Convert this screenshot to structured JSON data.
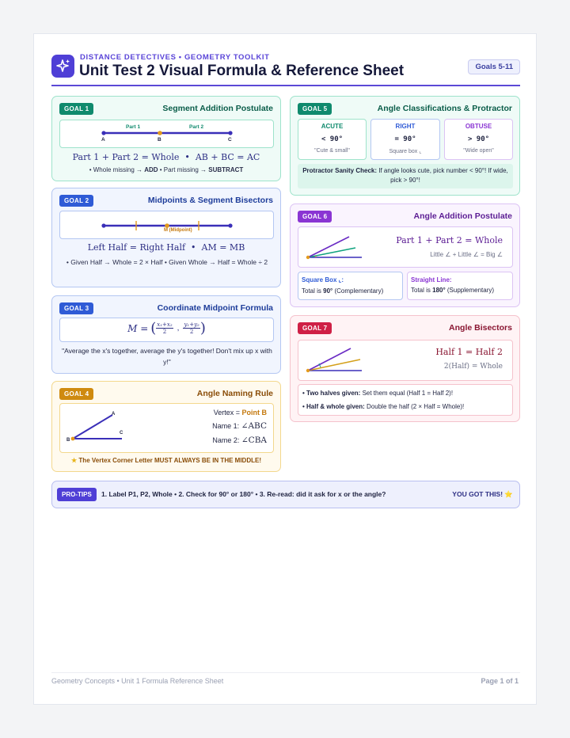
{
  "header": {
    "eyebrow": "DISTANCE DETECTIVES • GEOMETRY TOOLKIT",
    "title": "Unit Test 2 Visual Formula & Reference Sheet",
    "badge": "Goals 5-11",
    "icon": "sparkle-icon"
  },
  "goal1": {
    "tag": "GOAL 1",
    "title": "Segment Addition Postulate",
    "part1": "Part 1",
    "part2": "Part 2",
    "pointA": "A",
    "pointB": "B",
    "pointC": "C",
    "formula": "Part 1 + Part 2 = Whole  •  AB + BC = AC",
    "note_a": "• Whole missing → ",
    "note_add": "ADD",
    "note_b": " • Part missing → ",
    "note_sub": "SUBTRACT"
  },
  "goal2": {
    "tag": "GOAL 2",
    "title": "Midpoints & Segment Bisectors",
    "mid_label": "M (Midpoint)",
    "formula": "Left Half = Right Half  •  AM = MB",
    "note": "• Given Half → Whole = 2 × Half • Given Whole → Half = Whole ÷ 2"
  },
  "goal3": {
    "tag": "GOAL 3",
    "title": "Coordinate Midpoint Formula",
    "m": "M =",
    "x_num": "x₁+x₂",
    "y_num": "y₁+y₂",
    "den": "2",
    "quote": "\"Average the x's together, average the y's together! Don't mix up x with y!\""
  },
  "goal4": {
    "tag": "GOAL 4",
    "title": "Angle Naming Rule",
    "pointA": "A",
    "pointB": "B",
    "pointC": "C",
    "vertex_label": "Vertex = ",
    "vertex_value": "Point B",
    "name1_label": "Name 1: ",
    "name1_value": "∠ABC",
    "name2_label": "Name 2: ",
    "name2_value": "∠CBA",
    "star_icon": "star-icon",
    "rule": "The Vertex Corner Letter MUST ALWAYS BE IN THE MIDDLE!"
  },
  "goal5": {
    "tag": "GOAL 5",
    "title": "Angle Classifications & Protractor",
    "acute_name": "ACUTE",
    "acute_value": "< 90°",
    "acute_note": "\"Cute & small\"",
    "right_name": "RIGHT",
    "right_value": "= 90°",
    "right_note": "Square box ⌞",
    "obtuse_name": "OBTUSE",
    "obtuse_value": "> 90°",
    "obtuse_note": "\"Wide open\"",
    "check_label": "Protractor Sanity Check:",
    "check_text": " If angle looks cute, pick number < 90°! If wide, pick > 90°!"
  },
  "goal6": {
    "tag": "GOAL 6",
    "title": "Angle Addition Postulate",
    "formula": "Part 1 + Part 2 = Whole",
    "sub": "Little ∠ + Little ∠ = Big ∠",
    "box1_title": "Square Box ⌞:",
    "box1_text_a": "Total is ",
    "box1_bold": "90°",
    "box1_text_b": " (Complementary)",
    "box2_title": "Straight Line:",
    "box2_text_a": "Total is ",
    "box2_bold": "180°",
    "box2_text_b": " (Supplementary)"
  },
  "goal7": {
    "tag": "GOAL 7",
    "title": "Angle Bisectors",
    "formula": "Half 1 = Half 2",
    "sub": "2(Half) = Whole",
    "b1_label": "• Two halves given:",
    "b1_text": " Set them equal (Half 1 = Half 2)!",
    "b2_label": "• Half & whole given:",
    "b2_text": " Double the half (2 × Half = Whole)!"
  },
  "protips": {
    "tag": "PRO-TIPS",
    "text": "1. Label P1, P2, Whole • 2. Check for 90° or 180° • 3. Re-read: did it ask for x or the angle?",
    "cheer": "YOU GOT THIS! ⭐"
  },
  "footer": {
    "left": "Geometry Concepts • Unit 1 Formula Reference Sheet",
    "right": "Page 1 of 1"
  },
  "colors": {
    "brand": "#4f3fd6",
    "teal": "#0f8a6d",
    "blue": "#2f5bd6",
    "amber": "#cf8a10",
    "purple": "#8a35d3",
    "rose": "#cf2046",
    "segment": "#3a2fb8",
    "point_orange": "#e39a1d"
  }
}
